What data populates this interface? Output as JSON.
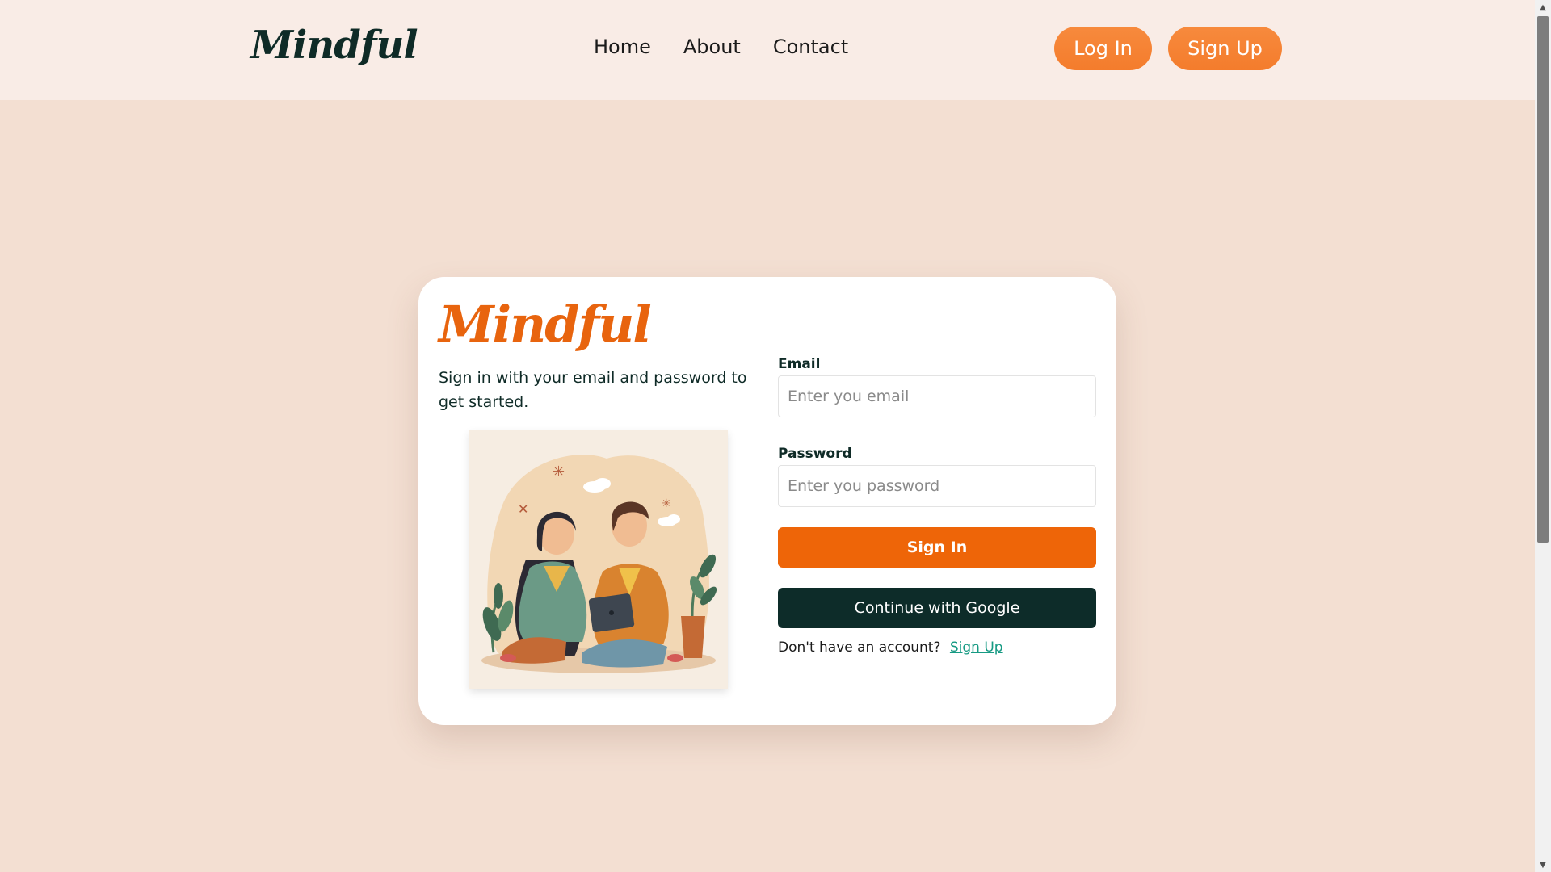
{
  "header": {
    "brand": "Mindful",
    "nav": [
      {
        "label": "Home"
      },
      {
        "label": "About"
      },
      {
        "label": "Contact"
      }
    ],
    "login_label": "Log In",
    "signup_label": "Sign Up"
  },
  "card": {
    "brand": "Mindful",
    "subtitle": "Sign in with your email and password to get started.",
    "illustration_icon": "couple-with-tablet-illustration",
    "email_label": "Email",
    "email_placeholder": "Enter you email",
    "password_label": "Password",
    "password_placeholder": "Enter you password",
    "signin_label": "Sign In",
    "google_label": "Continue with Google",
    "no_account_text": "Don't have an account?",
    "signup_link": "Sign Up"
  },
  "colors": {
    "page_bg": "#f3dfd2",
    "header_bg": "#f9ece6",
    "accent_orange": "#ee6508",
    "dark_green": "#0d2c29",
    "link_teal": "#169a83"
  },
  "scrollbar": {
    "up_icon": "scroll-up-arrow-icon",
    "down_icon": "scroll-down-arrow-icon"
  }
}
